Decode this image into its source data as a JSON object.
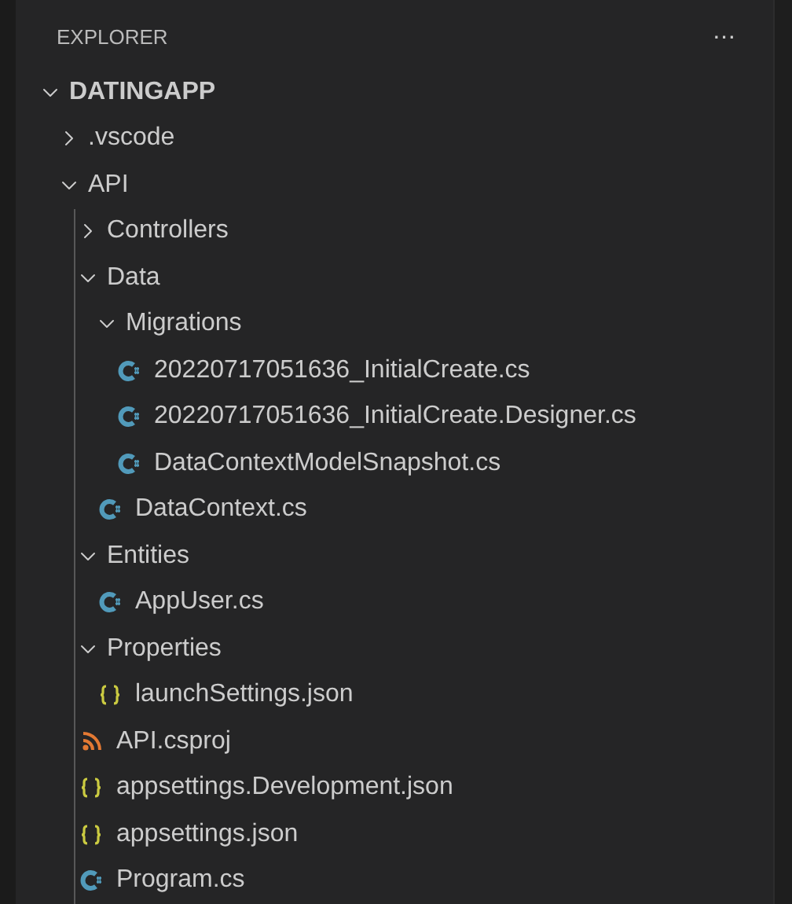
{
  "panel": {
    "title": "EXPLORER",
    "more": "···"
  },
  "tree": [
    {
      "kind": "root",
      "label": "DATINGAPP",
      "expanded": true,
      "children": [
        {
          "kind": "folder",
          "label": ".vscode",
          "expanded": false
        },
        {
          "kind": "folder",
          "label": "API",
          "expanded": true,
          "children": [
            {
              "kind": "folder",
              "label": "Controllers",
              "expanded": false
            },
            {
              "kind": "folder",
              "label": "Data",
              "expanded": true,
              "children": [
                {
                  "kind": "folder",
                  "label": "Migrations",
                  "expanded": true,
                  "children": [
                    {
                      "kind": "csharp",
                      "label": "20220717051636_InitialCreate.cs"
                    },
                    {
                      "kind": "csharp",
                      "label": "20220717051636_InitialCreate.Designer.cs"
                    },
                    {
                      "kind": "csharp",
                      "label": "DataContextModelSnapshot.cs"
                    }
                  ]
                },
                {
                  "kind": "csharp",
                  "label": "DataContext.cs"
                }
              ]
            },
            {
              "kind": "folder",
              "label": "Entities",
              "expanded": true,
              "children": [
                {
                  "kind": "csharp",
                  "label": "AppUser.cs"
                }
              ]
            },
            {
              "kind": "folder",
              "label": "Properties",
              "expanded": true,
              "children": [
                {
                  "kind": "json",
                  "label": "launchSettings.json"
                }
              ]
            },
            {
              "kind": "project",
              "label": "API.csproj"
            },
            {
              "kind": "json",
              "label": "appsettings.Development.json"
            },
            {
              "kind": "json",
              "label": "appsettings.json"
            },
            {
              "kind": "csharp",
              "label": "Program.cs"
            }
          ]
        }
      ]
    }
  ]
}
